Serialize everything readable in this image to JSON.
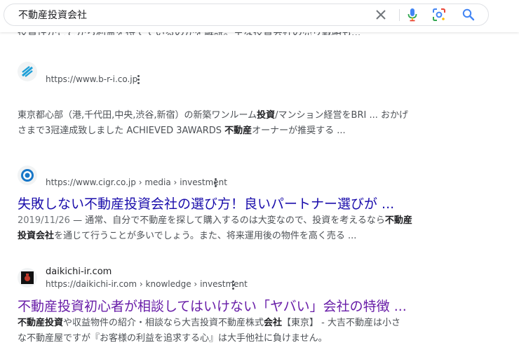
{
  "search": {
    "query": "不動産投資会社"
  },
  "top_fragment": {
    "text": "投資性がことがら利益を持てているのかを解説。主な投資会社の売り戦略も..."
  },
  "results": [
    {
      "url": "https://www.b-r-i.co.jp",
      "snippet": {
        "line1a": "東京都心部（港,千代田,中央,渋谷,新宿）の新築ワンルーム",
        "line1b": "投資",
        "line1c": "/マンション経営をBRI ... おかげ",
        "line2a": "さまで3冠達成致しました ACHIEVED 3AWARDS ",
        "line2b": "不動産",
        "line2c": "オーナーが推奨する ..."
      }
    },
    {
      "url": "https://www.cigr.co.jp",
      "crumb1": "media",
      "crumb2": "investment",
      "title": "失敗しない不動産投資会社の選び方！良いパートナー選びが ...",
      "snippet": {
        "date": "2019/11/26",
        "line1a": " — 通常、自分で不動産を探して購入するのは大変なので、投資を考えるなら",
        "line1b": "不動産",
        "line2a": "投資会社",
        "line2b": "を通じて行うことが多いでしょう。また、将来運用後の物件を高く売る ..."
      }
    },
    {
      "site_name": "daikichi-ir.com",
      "url": "https://daikichi-ir.com",
      "crumb1": "knowledge",
      "crumb2": "investment",
      "title": "不動産投資初心者が相談してはいけない「ヤバい」会社の特徴 ...",
      "snippet": {
        "line1a": "不動産投資",
        "line1b": "や収益物件の紹介・相談なら大吉投資不動産株式",
        "line1c": "会社",
        "line1d": "【東京】 - 大吉不動産は小さ",
        "line2a": "な不動産屋ですが『お客様の利益を追求する心』は大手他社に負けません。"
      }
    }
  ],
  "colors": {
    "link": "#1a0dab",
    "visited": "#681da8",
    "snippet": "#4d5156",
    "mic_blue": "#4285f4",
    "mic_red": "#ea4335",
    "search_blue": "#4285f4"
  },
  "separator": "›"
}
